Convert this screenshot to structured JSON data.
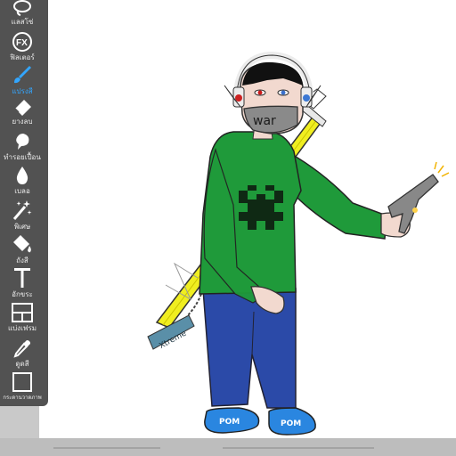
{
  "toolbar": {
    "tools": [
      {
        "id": "lasso",
        "label": "แลสโซ่",
        "icon": "lasso-icon",
        "active": false
      },
      {
        "id": "filter",
        "label": "ฟิลเตอร์",
        "icon": "fx-icon",
        "active": false
      },
      {
        "id": "brush",
        "label": "แปรงสี",
        "icon": "brush-icon",
        "active": true
      },
      {
        "id": "eraser",
        "label": "ยางลบ",
        "icon": "eraser-icon",
        "active": false
      },
      {
        "id": "smudge",
        "label": "ทำรอยเปื้อน",
        "icon": "smudge-icon",
        "active": false
      },
      {
        "id": "blur",
        "label": "เบลอ",
        "icon": "drop-icon",
        "active": false
      },
      {
        "id": "special",
        "label": "พิเศษ",
        "icon": "magic-wand-icon",
        "active": false
      },
      {
        "id": "fill",
        "label": "ถังสี",
        "icon": "paint-bucket-icon",
        "active": false
      },
      {
        "id": "text",
        "label": "อักขระ",
        "icon": "text-icon",
        "active": false
      },
      {
        "id": "frame",
        "label": "แบ่งเฟรม",
        "icon": "frame-divider-icon",
        "active": false
      },
      {
        "id": "eyedropper",
        "label": "ดูดสี",
        "icon": "eyedropper-icon",
        "active": false
      },
      {
        "id": "canvas",
        "label": "กระดานวาดภาพ",
        "icon": "canvas-icon",
        "active": false
      }
    ]
  },
  "artwork": {
    "mask_text": "war",
    "shoe_left_text": "POM",
    "shoe_right_text": "POM",
    "sword_text": "Xtreme"
  },
  "colors": {
    "toolbar_bg": "#525252",
    "active_accent": "#33a6ff",
    "sweater": "#1f9a3a",
    "pants": "#2b4aa8",
    "shoes": "#2a86e0",
    "sword": "#f0ee20"
  }
}
